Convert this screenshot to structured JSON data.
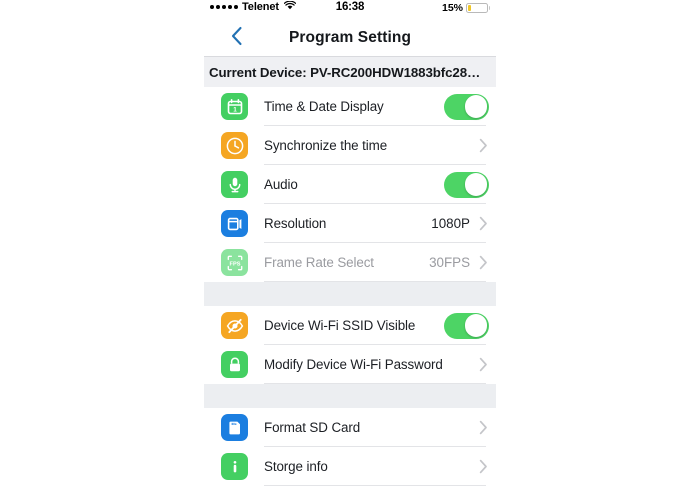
{
  "status_bar": {
    "signal_dots": 5,
    "carrier": "Telenet",
    "wifi_icon": "wifi-icon",
    "time": "16:38",
    "battery_percent": "15%",
    "battery_level": 15,
    "battery_color": "#efc629"
  },
  "nav": {
    "back_icon": "chevron-left-icon",
    "back_color": "#2271b3",
    "title": "Program Setting"
  },
  "device_banner": {
    "text": "Current Device: PV-RC200HDW1883bfc28…"
  },
  "colors": {
    "toggle_on": "#4dd465",
    "icon_green": "#44cf62",
    "icon_orange": "#f5a623",
    "icon_blue": "#1b7ee0",
    "separator_band": "#eceef1",
    "banner_bg": "#eff0f3",
    "chevron": "#c4c5c9"
  },
  "sections": [
    {
      "id": "recording",
      "rows": [
        {
          "id": "time-date-display",
          "label": "Time & Date Display",
          "icon": "calendar-icon",
          "icon_color": "green",
          "control": "toggle",
          "toggle_on": true,
          "value": "",
          "disabled": false
        },
        {
          "id": "synchronize-the-time",
          "label": "Synchronize the time",
          "icon": "clock-icon",
          "icon_color": "orange",
          "control": "chevron",
          "toggle_on": false,
          "value": "",
          "disabled": false
        },
        {
          "id": "audio",
          "label": "Audio",
          "icon": "microphone-icon",
          "icon_color": "green",
          "control": "toggle",
          "toggle_on": true,
          "value": "",
          "disabled": false
        },
        {
          "id": "resolution",
          "label": "Resolution",
          "icon": "video-frame-icon",
          "icon_color": "blue",
          "control": "chevron",
          "toggle_on": false,
          "value": "1080P",
          "disabled": false
        },
        {
          "id": "frame-rate-select",
          "label": "Frame Rate Select",
          "icon": "fps-icon",
          "icon_color": "green-faded",
          "control": "chevron",
          "toggle_on": false,
          "value": "30FPS",
          "disabled": true
        }
      ]
    },
    {
      "id": "wifi",
      "rows": [
        {
          "id": "device-wifi-ssid-visible",
          "label": "Device Wi-Fi SSID Visible",
          "icon": "eye-slash-icon",
          "icon_color": "orange",
          "control": "toggle",
          "toggle_on": true,
          "value": "",
          "disabled": false
        },
        {
          "id": "modify-device-wifi-password",
          "label": "Modify Device Wi-Fi Password",
          "icon": "lock-icon",
          "icon_color": "green",
          "control": "chevron",
          "toggle_on": false,
          "value": "",
          "disabled": false
        }
      ]
    },
    {
      "id": "storage",
      "rows": [
        {
          "id": "format-sd-card",
          "label": "Format SD Card",
          "icon": "sd-card-icon",
          "icon_color": "blue",
          "control": "chevron",
          "toggle_on": false,
          "value": "",
          "disabled": false
        },
        {
          "id": "storge-info",
          "label": "Storge info",
          "icon": "info-icon",
          "icon_color": "green",
          "control": "chevron",
          "toggle_on": false,
          "value": "",
          "disabled": false
        }
      ]
    }
  ]
}
